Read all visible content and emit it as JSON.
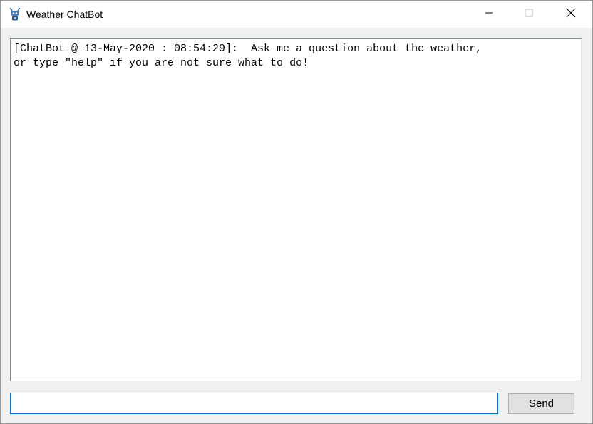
{
  "window": {
    "title": "Weather ChatBot",
    "app_icon": "robot-icon",
    "controls": {
      "minimize_icon": "minimize-icon",
      "maximize_icon": "maximize-icon",
      "close_icon": "close-icon"
    }
  },
  "chat": {
    "log_text": "[ChatBot @ 13-May-2020 : 08:54:29]:  Ask me a question about the weather,\nor type \"help\" if you are not sure what to do!"
  },
  "input": {
    "value": "",
    "placeholder": ""
  },
  "send_button": {
    "label": "Send"
  },
  "colors": {
    "accent": "#0078d7",
    "window_bg": "#f0f0f0",
    "titlebar_bg": "#ffffff",
    "button_bg": "#e1e1e1"
  }
}
